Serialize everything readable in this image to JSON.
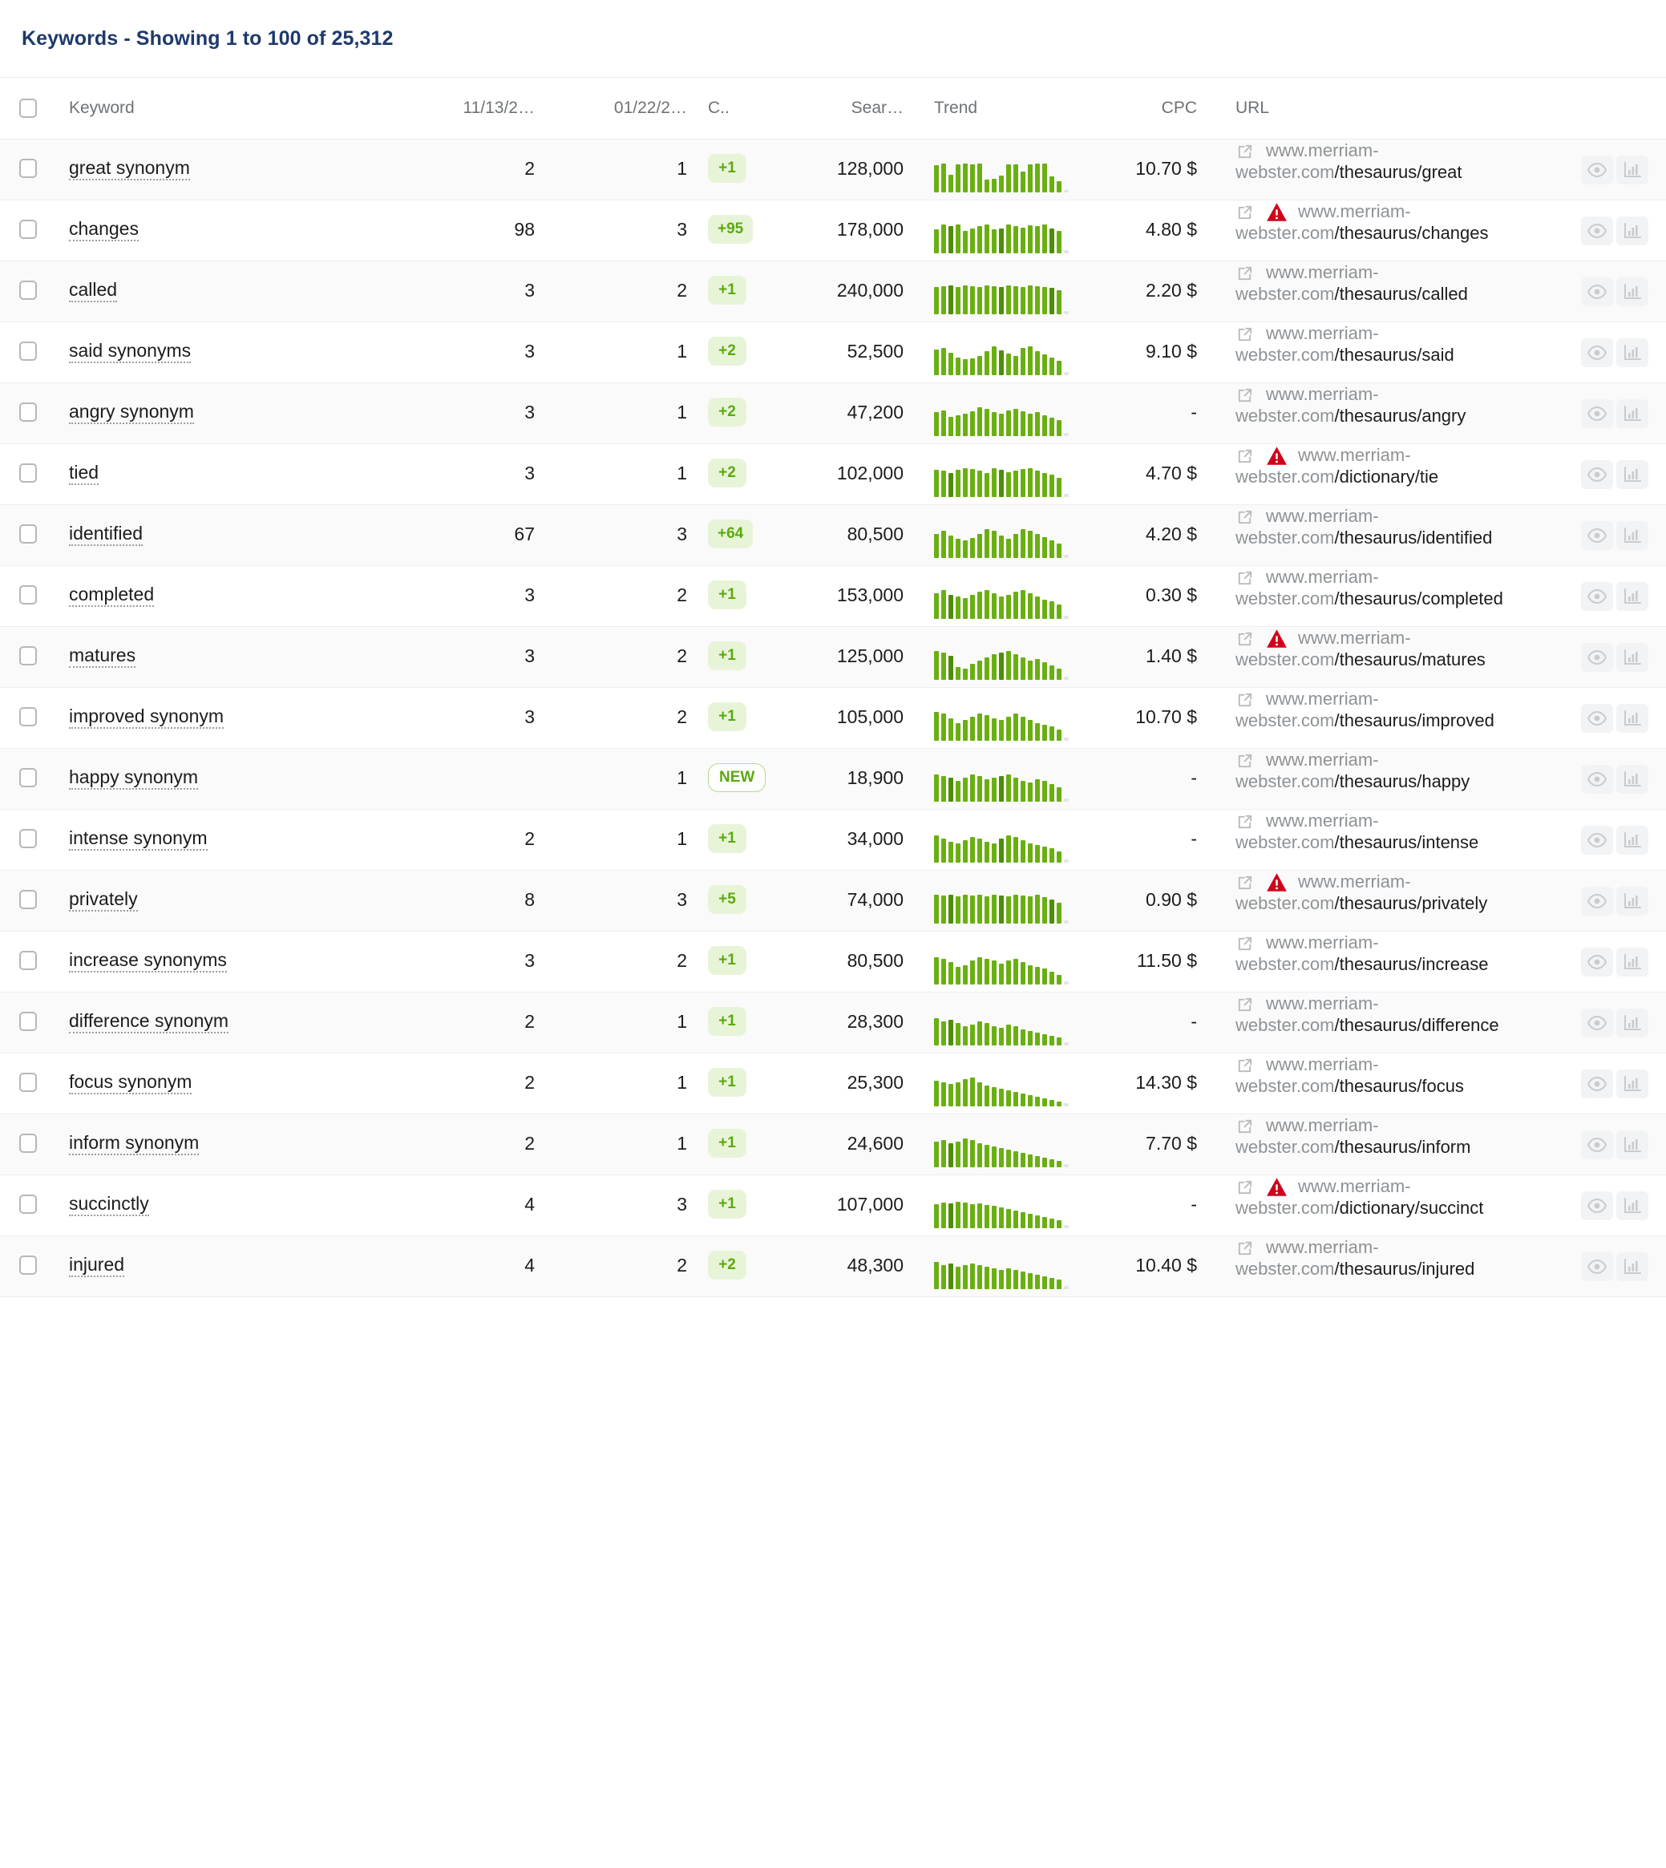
{
  "header": {
    "title": "Keywords - Showing 1 to 100 of 25,312",
    "title_color": "#1e3a6b"
  },
  "columns": {
    "checkbox": "",
    "keyword": "Keyword",
    "date1": "11/13/2…",
    "date2": "01/22/2…",
    "change": "C..",
    "volume": "Sear…",
    "trend": "Trend",
    "cpc": "CPC",
    "url": "URL"
  },
  "icons": {
    "external_link": "external-link-icon",
    "warning": "warning-triangle-icon",
    "preview": "eye-icon",
    "chart": "bar-chart-icon"
  },
  "colors": {
    "badge_bg": "#e8f4d8",
    "badge_text": "#5aaa0e",
    "sparkline": "#6aaf12",
    "sparkline_dark": "#4e8e07",
    "sparkline_empty": "#e4e5e6",
    "warning": "#d0021b",
    "row_alt": "#fafafa"
  },
  "rows": [
    {
      "keyword": "great synonym",
      "date1": "2",
      "date2": "1",
      "diff": "+1",
      "new": false,
      "volume": "128,000",
      "cpc": "10.70 $",
      "host": "www.merriam-webster.com",
      "path": "/thesaurus/great",
      "warning": false,
      "trend": [
        34,
        36,
        22,
        35,
        36,
        35,
        36,
        16,
        17,
        21,
        35,
        35,
        26,
        35,
        36,
        36,
        20,
        14,
        3
      ]
    },
    {
      "keyword": "changes",
      "date1": "98",
      "date2": "3",
      "diff": "+95",
      "new": false,
      "volume": "178,000",
      "cpc": "4.80 $",
      "host": "www.merriam-webster.com",
      "path": "/thesaurus/changes",
      "warning": true,
      "trend": [
        30,
        36,
        34,
        36,
        28,
        31,
        34,
        36,
        30,
        31,
        36,
        34,
        32,
        35,
        34,
        36,
        31,
        28,
        4
      ]
    },
    {
      "keyword": "called",
      "date1": "3",
      "date2": "2",
      "diff": "+1",
      "new": false,
      "volume": "240,000",
      "cpc": "2.20 $",
      "host": "www.merriam-webster.com",
      "path": "/thesaurus/called",
      "warning": false,
      "trend": [
        34,
        35,
        36,
        34,
        36,
        35,
        34,
        36,
        35,
        34,
        36,
        35,
        34,
        36,
        35,
        34,
        33,
        30,
        4
      ]
    },
    {
      "keyword": "said synonyms",
      "date1": "3",
      "date2": "1",
      "diff": "+2",
      "new": false,
      "volume": "52,500",
      "cpc": "9.10 $",
      "host": "www.merriam-webster.com",
      "path": "/thesaurus/said",
      "warning": false,
      "trend": [
        32,
        34,
        28,
        22,
        20,
        21,
        24,
        30,
        36,
        31,
        27,
        24,
        34,
        36,
        30,
        26,
        22,
        18,
        4
      ]
    },
    {
      "keyword": "angry synonym",
      "date1": "3",
      "date2": "1",
      "diff": "+2",
      "new": false,
      "volume": "47,200",
      "cpc": "-",
      "host": "www.merriam-webster.com",
      "path": "/thesaurus/angry",
      "warning": false,
      "trend": [
        30,
        32,
        24,
        26,
        28,
        31,
        36,
        34,
        30,
        28,
        32,
        34,
        31,
        28,
        30,
        26,
        23,
        20,
        4
      ]
    },
    {
      "keyword": "tied",
      "date1": "3",
      "date2": "1",
      "diff": "+2",
      "new": false,
      "volume": "102,000",
      "cpc": "4.70 $",
      "host": "www.merriam-webster.com",
      "path": "/dictionary/tie",
      "warning": true,
      "trend": [
        34,
        33,
        30,
        34,
        36,
        35,
        33,
        30,
        36,
        34,
        31,
        33,
        35,
        36,
        33,
        30,
        28,
        24,
        4
      ]
    },
    {
      "keyword": "identified",
      "date1": "67",
      "date2": "3",
      "diff": "+64",
      "new": false,
      "volume": "80,500",
      "cpc": "4.20 $",
      "host": "www.merriam-webster.com",
      "path": "/thesaurus/identified",
      "warning": false,
      "trend": [
        30,
        34,
        28,
        24,
        22,
        25,
        30,
        36,
        34,
        28,
        24,
        30,
        36,
        34,
        30,
        26,
        22,
        18,
        4
      ]
    },
    {
      "keyword": "completed",
      "date1": "3",
      "date2": "2",
      "diff": "+1",
      "new": false,
      "volume": "153,000",
      "cpc": "0.30 $",
      "host": "www.merriam-webster.com",
      "path": "/thesaurus/completed",
      "warning": false,
      "trend": [
        32,
        36,
        30,
        28,
        26,
        30,
        34,
        36,
        32,
        28,
        30,
        34,
        36,
        32,
        28,
        24,
        22,
        18,
        4
      ]
    },
    {
      "keyword": "matures",
      "date1": "3",
      "date2": "2",
      "diff": "+1",
      "new": false,
      "volume": "125,000",
      "cpc": "1.40 $",
      "host": "www.merriam-webster.com",
      "path": "/thesaurus/matures",
      "warning": true,
      "trend": [
        36,
        34,
        30,
        16,
        14,
        20,
        24,
        28,
        32,
        34,
        36,
        32,
        28,
        24,
        26,
        22,
        18,
        14,
        4
      ]
    },
    {
      "keyword": "improved synonym",
      "date1": "3",
      "date2": "2",
      "diff": "+1",
      "new": false,
      "volume": "105,000",
      "cpc": "10.70 $",
      "host": "www.merriam-webster.com",
      "path": "/thesaurus/improved",
      "warning": false,
      "trend": [
        36,
        34,
        28,
        22,
        26,
        30,
        34,
        32,
        28,
        26,
        30,
        34,
        30,
        26,
        22,
        20,
        18,
        14,
        4
      ]
    },
    {
      "keyword": "happy synonym",
      "date1": "",
      "date2": "1",
      "diff": "NEW",
      "new": true,
      "volume": "18,900",
      "cpc": "-",
      "host": "www.merriam-webster.com",
      "path": "/thesaurus/happy",
      "warning": false,
      "trend": [
        34,
        32,
        30,
        26,
        30,
        34,
        32,
        28,
        30,
        32,
        34,
        30,
        26,
        24,
        28,
        26,
        22,
        18,
        4
      ]
    },
    {
      "keyword": "intense synonym",
      "date1": "2",
      "date2": "1",
      "diff": "+1",
      "new": false,
      "volume": "34,000",
      "cpc": "-",
      "host": "www.merriam-webster.com",
      "path": "/thesaurus/intense",
      "warning": false,
      "trend": [
        34,
        30,
        26,
        24,
        28,
        32,
        30,
        26,
        24,
        30,
        34,
        32,
        28,
        24,
        22,
        20,
        18,
        14,
        4
      ]
    },
    {
      "keyword": "privately",
      "date1": "8",
      "date2": "3",
      "diff": "+5",
      "new": false,
      "volume": "74,000",
      "cpc": "0.90 $",
      "host": "www.merriam-webster.com",
      "path": "/thesaurus/privately",
      "warning": true,
      "trend": [
        36,
        35,
        36,
        34,
        36,
        35,
        36,
        34,
        36,
        35,
        34,
        36,
        35,
        34,
        36,
        33,
        30,
        26,
        4
      ]
    },
    {
      "keyword": "increase synonyms",
      "date1": "3",
      "date2": "2",
      "diff": "+1",
      "new": false,
      "volume": "80,500",
      "cpc": "11.50 $",
      "host": "www.merriam-webster.com",
      "path": "/thesaurus/increase",
      "warning": false,
      "trend": [
        34,
        32,
        28,
        22,
        24,
        30,
        34,
        32,
        30,
        26,
        30,
        32,
        28,
        24,
        22,
        20,
        16,
        12,
        4
      ]
    },
    {
      "keyword": "difference synonym",
      "date1": "2",
      "date2": "1",
      "diff": "+1",
      "new": false,
      "volume": "28,300",
      "cpc": "-",
      "host": "www.merriam-webster.com",
      "path": "/thesaurus/difference",
      "warning": false,
      "trend": [
        34,
        30,
        32,
        28,
        24,
        26,
        30,
        28,
        24,
        22,
        26,
        24,
        20,
        18,
        16,
        14,
        12,
        10,
        4
      ]
    },
    {
      "keyword": "focus synonym",
      "date1": "2",
      "date2": "1",
      "diff": "+1",
      "new": false,
      "volume": "25,300",
      "cpc": "14.30 $",
      "host": "www.merriam-webster.com",
      "path": "/thesaurus/focus",
      "warning": false,
      "trend": [
        32,
        30,
        28,
        30,
        34,
        36,
        30,
        26,
        24,
        22,
        20,
        18,
        16,
        14,
        12,
        10,
        8,
        6,
        4
      ]
    },
    {
      "keyword": "inform synonym",
      "date1": "2",
      "date2": "1",
      "diff": "+1",
      "new": false,
      "volume": "24,600",
      "cpc": "7.70 $",
      "host": "www.merriam-webster.com",
      "path": "/thesaurus/inform",
      "warning": false,
      "trend": [
        32,
        34,
        30,
        32,
        36,
        34,
        30,
        28,
        26,
        24,
        22,
        20,
        18,
        16,
        14,
        12,
        10,
        8,
        4
      ]
    },
    {
      "keyword": "succinctly",
      "date1": "4",
      "date2": "3",
      "diff": "+1",
      "new": false,
      "volume": "107,000",
      "cpc": "-",
      "host": "www.merriam-webster.com",
      "path": "/dictionary/succinct",
      "warning": true,
      "trend": [
        30,
        32,
        31,
        33,
        32,
        30,
        31,
        29,
        28,
        26,
        24,
        22,
        20,
        18,
        16,
        14,
        12,
        10,
        4
      ]
    },
    {
      "keyword": "injured",
      "date1": "4",
      "date2": "2",
      "diff": "+2",
      "new": false,
      "volume": "48,300",
      "cpc": "10.40 $",
      "host": "www.merriam-webster.com",
      "path": "/thesaurus/injured",
      "warning": false,
      "trend": [
        34,
        30,
        32,
        28,
        30,
        32,
        30,
        28,
        26,
        24,
        26,
        24,
        22,
        20,
        18,
        16,
        14,
        12,
        4
      ]
    }
  ]
}
